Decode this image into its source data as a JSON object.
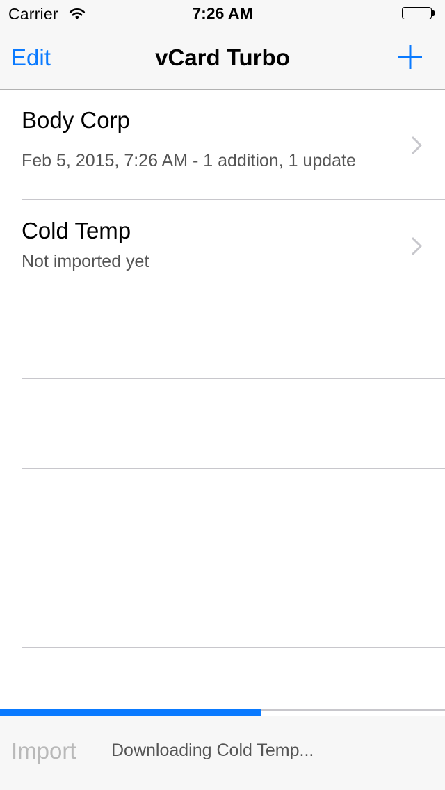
{
  "status_bar": {
    "carrier": "Carrier",
    "time": "7:26 AM",
    "wifi_icon": "wifi-icon",
    "battery_icon": "battery-icon"
  },
  "nav_bar": {
    "edit_label": "Edit",
    "title": "vCard Turbo",
    "add_icon": "plus-icon"
  },
  "list": {
    "items": [
      {
        "title": "Body Corp",
        "subtitle": "Feb 5, 2015, 7:26 AM - 1 addition, 1 update",
        "accessory_icon": "chevron-right-icon"
      },
      {
        "title": "Cold Temp",
        "subtitle": "Not imported yet",
        "accessory_icon": "chevron-right-icon"
      }
    ]
  },
  "progress": {
    "value": 0.587
  },
  "toolbar": {
    "import_label": "Import",
    "status": "Downloading Cold Temp..."
  },
  "colors": {
    "accent": "#0a7aff",
    "disabled": "#b9b9b9",
    "secondary_text": "#555555",
    "separator": "#c8c7cc"
  }
}
